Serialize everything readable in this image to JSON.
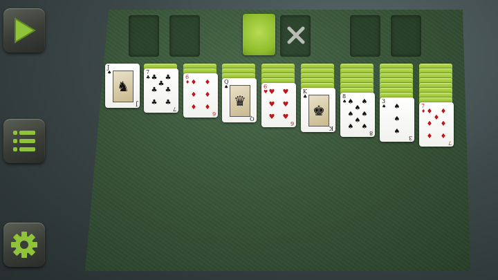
{
  "sidebar": {
    "play_icon": "play-triangle-icon",
    "menu_icon": "menu-list-icon",
    "settings_icon": "gear-icon",
    "accent": "#8fc43a"
  },
  "stock": {
    "back_color": "#9cc93a",
    "redeal_icon": "x-icon"
  },
  "tableau": [
    {
      "hidden": 0,
      "faceup": [
        {
          "rank": "J",
          "suit": "♠",
          "color": "black"
        }
      ]
    },
    {
      "hidden": 1,
      "faceup": [
        {
          "rank": "7",
          "suit": "♣",
          "color": "black"
        }
      ]
    },
    {
      "hidden": 2,
      "faceup": [
        {
          "rank": "6",
          "suit": "♦",
          "color": "red"
        }
      ]
    },
    {
      "hidden": 3,
      "faceup": [
        {
          "rank": "Q",
          "suit": "♠",
          "color": "black"
        }
      ]
    },
    {
      "hidden": 4,
      "faceup": [
        {
          "rank": "6",
          "suit": "♥",
          "color": "red"
        }
      ]
    },
    {
      "hidden": 5,
      "faceup": [
        {
          "rank": "K",
          "suit": "♣",
          "color": "black"
        }
      ]
    },
    {
      "hidden": 6,
      "faceup": [
        {
          "rank": "8",
          "suit": "♠",
          "color": "black"
        }
      ]
    },
    {
      "hidden": 7,
      "faceup": [
        {
          "rank": "3",
          "suit": "♠",
          "color": "black"
        }
      ]
    },
    {
      "hidden": 8,
      "faceup": [
        {
          "rank": "7",
          "suit": "♦",
          "color": "red"
        }
      ]
    }
  ]
}
